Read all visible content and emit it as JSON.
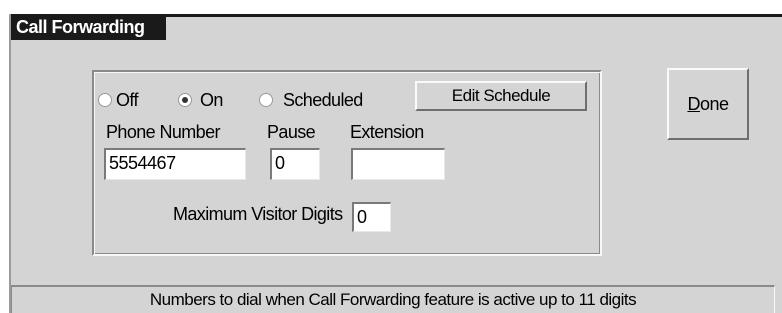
{
  "window": {
    "title": "Call Forwarding"
  },
  "mode": {
    "options": [
      {
        "label": "Off",
        "checked": false
      },
      {
        "label": "On",
        "checked": true
      },
      {
        "label": "Scheduled",
        "checked": false
      }
    ]
  },
  "buttons": {
    "edit_schedule": "Edit Schedule",
    "done_mnemonic": "D",
    "done_rest": "one"
  },
  "fields": {
    "phone_number": {
      "label": "Phone Number",
      "value": "5554467"
    },
    "pause": {
      "label": "Pause",
      "value": "0"
    },
    "extension": {
      "label": "Extension",
      "value": ""
    },
    "max_visitor_digits": {
      "label": "Maximum Visitor Digits",
      "value": "0"
    }
  },
  "status": {
    "text": "Numbers to dial when Call Forwarding feature is active up to 11 digits"
  }
}
